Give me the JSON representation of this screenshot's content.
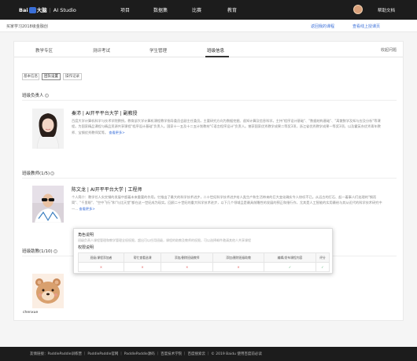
{
  "header": {
    "logo_text": "Bai",
    "logo_text2": "大脑",
    "studio": "AI Studio",
    "nav": [
      "项目",
      "数据集",
      "比赛",
      "教育"
    ],
    "help": "帮助文档"
  },
  "breadcrumb": {
    "text": "买家学习2018级金融创",
    "link_back": "返回我的课程",
    "link_online": "查看线上授课页"
  },
  "tabs": [
    "教学专区",
    "测评考试",
    "学生管理",
    "班级信息"
  ],
  "favorite": "收起问题",
  "subtabs": [
    "基本信息",
    "团队设置",
    "操作记录"
  ],
  "sections": {
    "owner_title": "班级负责人",
    "teachers_title": "班级教师(1/5)",
    "assistants_title": "班级助教(1/10)"
  },
  "owner": {
    "name": "秦沛 | AI开平平台大学 | 副教授",
    "bio": "百度大学计算机科学与技术学院教授。教育部大学计算机课程教学指导委员会副主任委员。主要研究方向为数据挖掘、遥知计算及信息科学。主持\"程序设计基础\"、\"数据结构基础\"、\"离散数学及知与应及分析\"等课程。为国家精品课程与精品资源共享课程\"程序设计基础\"负责人。国家十一五及十二五计划教材\"C语言程序设计\"负责人。曾获国家优秀教学成果二等奖3项，浙江省优秀教学成果一等奖3项，以及霍英东优秀青年教师、宝钢优秀教师奖等。",
    "more": "查看更多>"
  },
  "teacher": {
    "name": "陈文龙 | AI开平平台大学 | 工程师",
    "bio": "个人简介：教学任人实交钢的发展中超着未来重要的作用。它推出了最大的科学技术进步，二十世纪科学技术进步给人类生产和生活带来的巨大变化确实令人惊叹不已。从远古的打石、起一着事人们处理的\"钢而简\"、\"千里眼\"、\"空中飞行\"和\"与比天堂\"都在这一世纪成为现实。回顾二十世纪的重大科学技术进步，以下几个领域且是最具前瞻性的发展的预正和指行作，尤其是人工智能的实用最给与其从近代的科学技术研究中一...",
    "more": "查看更多>"
  },
  "assistant": {
    "name": "chenxue"
  },
  "popup": {
    "title1": "角色说明",
    "desc1": "班级负责人课程管理和教学管理全权权限，超出可以任用班级，课程的助教及教师的权限，可以选择邮件邀请其他人共享课程",
    "title2": "权限说明",
    "headers": [
      "班级/课程添加者",
      "帮忙查看选课",
      "添加/删除班级教师",
      "添加/删除班级助教",
      "编辑/发布课程内容",
      "评分"
    ],
    "row": [
      "x",
      "x",
      "x",
      "x",
      "ok",
      "ok"
    ],
    "x_mark": "✕",
    "ok_mark": "✓"
  },
  "footer": {
    "text": "友情链接：PaddlePaddle训练营 ｜ PaddlePaddle官网 ｜ PaddlePaddle源码 ｜ 百度技术学院 ｜ 百度搜索云 ｜ © 2019 Baidu 使用百度前必读"
  },
  "colors": {
    "accent": "#3a6fd8",
    "dark": "#1c1c1c",
    "error": "#e05050",
    "success": "#3aa55d"
  }
}
